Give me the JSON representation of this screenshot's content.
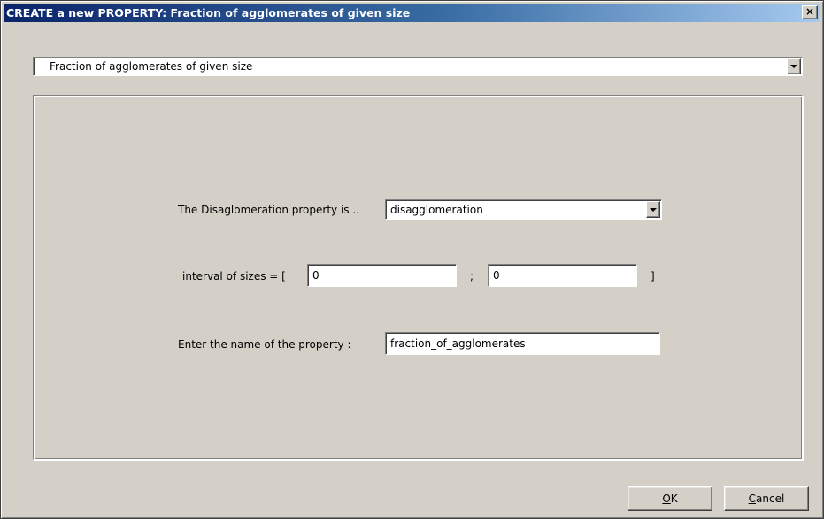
{
  "window": {
    "title": "CREATE a new PROPERTY: Fraction of agglomerates of given size",
    "close_glyph": "×"
  },
  "property_type": {
    "selected": "Fraction of agglomerates of given size"
  },
  "form": {
    "disagglomeration_label": "The Disaglomeration property is ..",
    "disagglomeration_selected": "disagglomeration",
    "interval_label": "interval of sizes = [",
    "interval_separator": ";",
    "interval_close": "]",
    "interval_min": "0",
    "interval_max": "0",
    "name_label": "Enter the name of the property :",
    "name_value": "fraction_of_agglomerates"
  },
  "buttons": {
    "ok_mnemonic": "O",
    "ok_rest": "K",
    "cancel_mnemonic": "C",
    "cancel_rest": "ancel"
  },
  "icons": {
    "close": "close-icon",
    "dropdown": "chevron-down-icon"
  }
}
